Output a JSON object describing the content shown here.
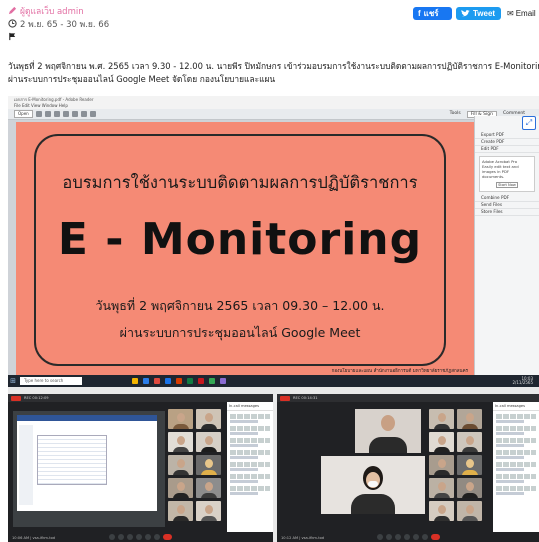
{
  "post": {
    "author": "ผู้ดูแลเว็บ admin",
    "date_range": "2 พ.ย. 65 - 30 พ.ย. 66",
    "description_line1": "วันพุธที่ 2 พฤศจิกายน พ.ศ. 2565 เวลา 9.30 - 12.00 น. นายพีร ปิทมักษกร เข้าร่วมอบรมการใช้งานระบบติดตามผลการปฏิบัติราชการ E-Monitoring",
    "description_line2": "ผ่านระบบการประชุมออนไลน์ Google Meet จัดโดย กองนโยบายและแผน"
  },
  "share": {
    "facebook": "แชร์",
    "twitter": "Tweet",
    "email": "Email"
  },
  "reader": {
    "title": "เอกสาร E-Monitoring.pdf - Adobe Reader",
    "menu": "File  Edit  View  Window  Help",
    "open": "Open",
    "tools": "Tools",
    "fill_sign": "Fill & Sign",
    "comment": "Comment",
    "panel": {
      "export_pdf": "Export PDF",
      "create_pdf": "Create PDF",
      "edit_pdf": "Edit PDF",
      "box_title": "Adobe Acrobat Pro",
      "box_text": "Easily edit text and images in PDF documents.",
      "box_btn": "Start Now",
      "combine": "Combine PDF",
      "send_files": "Send Files",
      "store_files": "Store Files"
    }
  },
  "slide": {
    "line1": "อบรมการใช้งานระบบติดตามผลการปฏิบัติราชการ",
    "big": "E - Monitoring",
    "line3": "วันพุธที่ 2 พฤศจิกายน 2565 เวลา  09.30 – 12.00 น.",
    "line4": "ผ่านระบบการประชุมออนไลน์ Google Meet",
    "footer": "กองนโยบายและแผน สำนักงานอธิการบดี มหาวิทยาลัยราชภัฏสกลนคร"
  },
  "taskbar": {
    "search": "Type here to search",
    "time": "10:03",
    "date": "2/11/2565"
  },
  "meet_left": {
    "top_label": "REC  00:12:09",
    "bottom_label": "10:06 AM | vsa-ifkm-tod",
    "chat_header": "In-call messages"
  },
  "meet_right": {
    "top_label": "REC  00:14:31",
    "bottom_label": "10:12 AM | vsa-ifkm-tod",
    "chat_header": "In-call messages"
  }
}
